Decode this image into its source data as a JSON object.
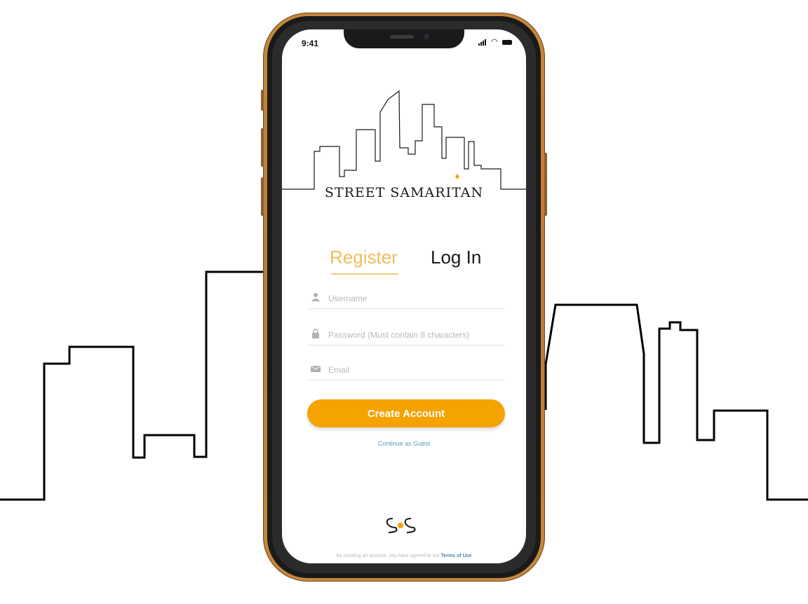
{
  "status": {
    "time": "9:41"
  },
  "brand": {
    "name": "STREET SAMARITAN",
    "mark": "SS"
  },
  "tabs": {
    "register": "Register",
    "login": "Log In"
  },
  "form": {
    "username_placeholder": "Username",
    "password_placeholder": "Password (Must contain 8 characters)",
    "email_placeholder": "Email",
    "submit_label": "Create Account"
  },
  "guest_link": "Continue as Guest",
  "terms": {
    "prefix": "By creating an account, you have agreed to our",
    "link": "Terms of Use"
  },
  "icons": {
    "username": "user-icon",
    "password": "lock-icon",
    "email": "envelope-icon"
  },
  "colors": {
    "accent": "#f5a300",
    "tab_active": "#f0bd5a",
    "link": "#5a9bc0",
    "phone_frame": "#c8873a"
  }
}
